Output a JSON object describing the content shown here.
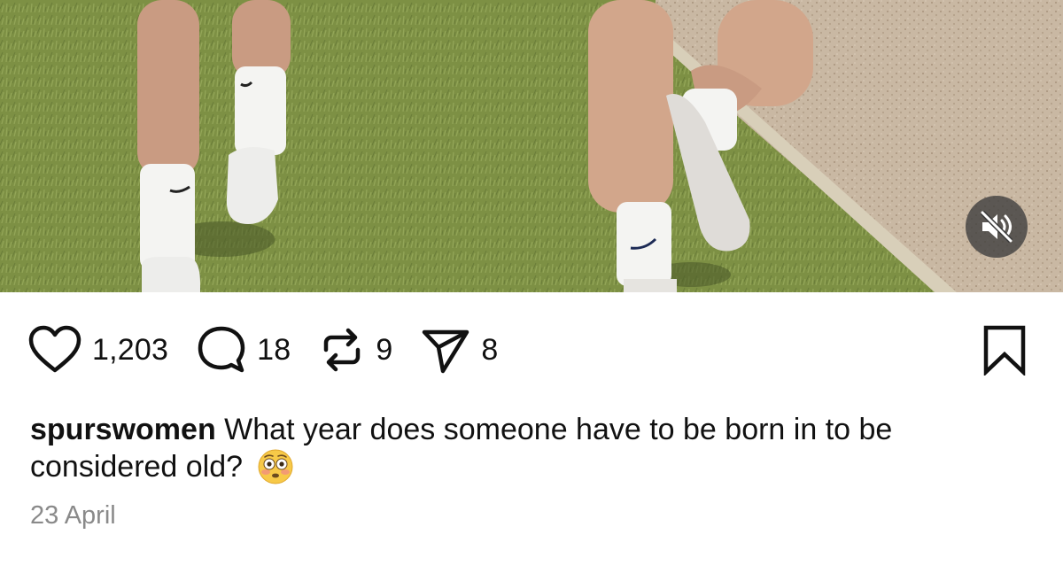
{
  "media": {
    "icons": {
      "mute": "speaker-muted-icon"
    }
  },
  "actions": {
    "likes": {
      "icon": "heart-icon",
      "count": "1,203"
    },
    "comments": {
      "icon": "comment-icon",
      "count": "18"
    },
    "reposts": {
      "icon": "repost-icon",
      "count": "9"
    },
    "shares": {
      "icon": "send-icon",
      "count": "8"
    },
    "save": {
      "icon": "bookmark-icon"
    }
  },
  "post": {
    "username": "spurswomen",
    "caption": "What year does someone have to be born in to be considered old?",
    "emoji": "flushed-face-emoji",
    "date": "23 April"
  },
  "colors": {
    "text": "#111111",
    "muted_text": "#8a8a8a",
    "mute_button_bg": "#3c3c3c"
  }
}
